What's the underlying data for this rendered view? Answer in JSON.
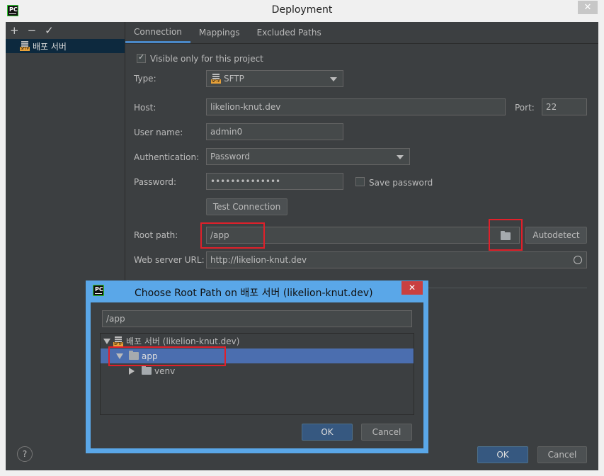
{
  "window": {
    "title": "Deployment",
    "close_glyph": "✕"
  },
  "sidebar": {
    "toolbar": {
      "add": "+",
      "remove": "−",
      "apply": "✓"
    },
    "servers": [
      {
        "label": "배포 서버"
      }
    ]
  },
  "tabs": [
    {
      "label": "Connection"
    },
    {
      "label": "Mappings"
    },
    {
      "label": "Excluded Paths"
    }
  ],
  "connection": {
    "visible_only_label": "Visible only for this project",
    "type_label": "Type:",
    "type_value": "SFTP",
    "host_label": "Host:",
    "host_value": "likelion-knut.dev",
    "port_label": "Port:",
    "port_value": "22",
    "username_label": "User name:",
    "username_value": "admin0",
    "auth_label": "Authentication:",
    "auth_value": "Password",
    "password_label": "Password:",
    "password_value": "••••••••••••••",
    "save_password_label": "Save password",
    "test_button": "Test Connection",
    "root_label": "Root path:",
    "root_value": "/app",
    "autodetect_button": "Autodetect",
    "web_label": "Web server URL:",
    "web_value": "http://likelion-knut.dev"
  },
  "root_dialog": {
    "title": "Choose Root Path on 배포 서버 (likelion-knut.dev)",
    "close_glyph": "✕",
    "path_value": "/app",
    "tree": [
      {
        "label": "배포 서버 (likelion-knut.dev)"
      },
      {
        "label": "app"
      },
      {
        "label": "venv"
      }
    ],
    "ok": "OK",
    "cancel": "Cancel"
  },
  "footer": {
    "help": "?",
    "ok": "OK",
    "cancel": "Cancel"
  }
}
